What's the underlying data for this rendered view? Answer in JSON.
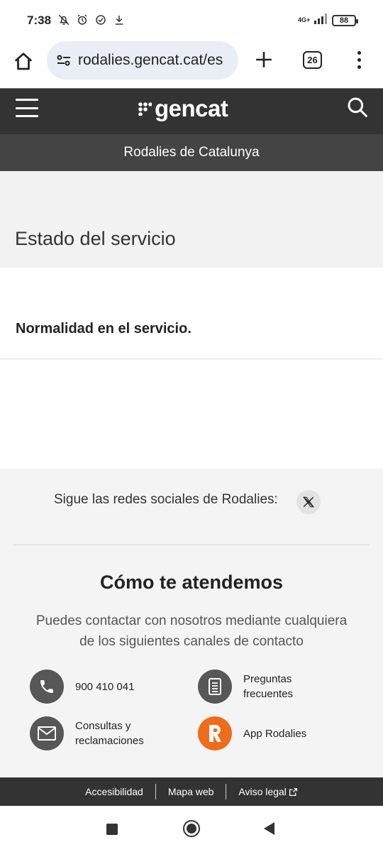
{
  "status_bar": {
    "time": "7:38",
    "network": "4G+",
    "battery": "88"
  },
  "browser": {
    "url": "rodalies.gencat.cat/es",
    "tab_count": "26"
  },
  "site": {
    "logo_text": "gencat",
    "subtitle": "Rodalies de Catalunya"
  },
  "main": {
    "section_title": "Estado del servicio",
    "status_message": "Normalidad en el servicio."
  },
  "footer": {
    "social_text": "Sigue las redes sociales de Rodalies:",
    "attend_title": "Cómo te atendemos",
    "attend_desc": "Puedes contactar con nosotros mediante cualquiera de los siguientes canales de contacto",
    "contacts": [
      {
        "label": "900 410 041",
        "icon": "phone-icon"
      },
      {
        "label": "Preguntas frecuentes",
        "icon": "document-list-icon"
      },
      {
        "label": "Consultas y reclamaciones",
        "icon": "envelope-icon"
      },
      {
        "label": "App Rodalies",
        "icon": "rodalies-r-icon"
      }
    ],
    "links": [
      {
        "label": "Accesibilidad"
      },
      {
        "label": "Mapa web"
      },
      {
        "label": "Aviso legal"
      }
    ]
  },
  "colors": {
    "header_bg": "#333333",
    "subheader_bg": "#444444",
    "rodalies_orange": "#ef6c1a",
    "icon_circle": "#575757"
  }
}
